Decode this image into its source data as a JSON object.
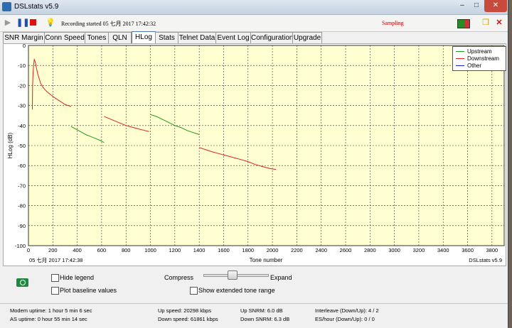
{
  "window": {
    "title": "DSLstats v5.9",
    "minimize": "–",
    "maximize": "□",
    "close": "✕"
  },
  "toolbar": {
    "recording_text": "Recording started 05 七月 2017 17:42:32",
    "sampling_text": "Sampling",
    "icons": [
      "play-icon",
      "pause-icon",
      "stop-icon",
      "lightbulb-icon",
      "battery-icon",
      "copy-icon",
      "close-red-icon"
    ]
  },
  "tabs": [
    "SNR Margin",
    "Conn Speed",
    "Tones",
    "QLN",
    "HLog",
    "Stats",
    "Telnet Data",
    "Event Log",
    "Configuration",
    "Upgrade"
  ],
  "active_tab": "HLog",
  "chart_data": {
    "type": "line",
    "title": "",
    "xlabel": "Tone number",
    "ylabel": "HLog (dB)",
    "xlim": [
      0,
      3900
    ],
    "ylim": [
      -100,
      0
    ],
    "xticks": [
      0,
      200,
      400,
      600,
      800,
      1000,
      1200,
      1400,
      1600,
      1800,
      2000,
      2200,
      2400,
      2600,
      2800,
      3000,
      3200,
      3400,
      3600,
      3800
    ],
    "yticks": [
      0,
      -10,
      -20,
      -30,
      -40,
      -50,
      -60,
      -70,
      -80,
      -90,
      -100
    ],
    "grid": true,
    "legend_position": "top-right",
    "timestamp": "05 七月 2017 17:42:38",
    "watermark": "DSLstats v5.9",
    "series": [
      {
        "name": "Upstream",
        "color": "#1a9a1a",
        "segments": [
          [
            [
              350,
              -40.5
            ],
            [
              410,
              -42.5
            ],
            [
              470,
              -44.5
            ],
            [
              530,
              -46
            ],
            [
              590,
              -47.5
            ],
            [
              620,
              -48.5
            ]
          ],
          [
            [
              1000,
              -34.5
            ],
            [
              1050,
              -35.5
            ],
            [
              1100,
              -37
            ],
            [
              1150,
              -38.5
            ],
            [
              1200,
              -40
            ],
            [
              1250,
              -41
            ],
            [
              1300,
              -42.5
            ],
            [
              1350,
              -43.5
            ],
            [
              1400,
              -44.5
            ]
          ]
        ]
      },
      {
        "name": "Downstream",
        "color": "#e02020",
        "segments": [
          [
            [
              32,
              -32
            ],
            [
              34,
              -20
            ],
            [
              38,
              -14
            ],
            [
              42,
              -10
            ],
            [
              48,
              -7
            ],
            [
              55,
              -8
            ],
            [
              65,
              -11
            ],
            [
              75,
              -14
            ],
            [
              85,
              -16
            ],
            [
              100,
              -19
            ],
            [
              120,
              -21
            ],
            [
              150,
              -23
            ],
            [
              200,
              -25.5
            ],
            [
              250,
              -27.5
            ],
            [
              300,
              -29.5
            ],
            [
              350,
              -30.5
            ]
          ],
          [
            [
              620,
              -35.5
            ],
            [
              680,
              -37
            ],
            [
              740,
              -38.5
            ],
            [
              800,
              -40
            ],
            [
              860,
              -41
            ],
            [
              920,
              -42
            ],
            [
              990,
              -43
            ]
          ],
          [
            [
              1400,
              -51
            ],
            [
              1450,
              -52
            ],
            [
              1500,
              -53
            ],
            [
              1560,
              -54
            ],
            [
              1620,
              -55
            ],
            [
              1680,
              -56
            ],
            [
              1740,
              -57
            ],
            [
              1800,
              -58
            ],
            [
              1860,
              -59.5
            ],
            [
              1920,
              -60.5
            ],
            [
              1980,
              -61.5
            ],
            [
              2030,
              -62
            ]
          ]
        ]
      },
      {
        "name": "Other",
        "color": "#2020d0",
        "segments": []
      }
    ]
  },
  "controls": {
    "hide_legend": "Hide legend",
    "plot_baseline": "Plot baseline values",
    "compress": "Compress",
    "expand": "Expand",
    "show_extended": "Show extended tone range",
    "camera_icon": "camera-icon"
  },
  "status": {
    "modem_uptime": "Modem uptime:  1 hour 5 min 6 sec",
    "as_uptime": "AS uptime:  0 hour 55 min 14 sec",
    "up_speed": "Up speed: 20298 kbps",
    "down_speed": "Down speed: 61861 kbps",
    "up_snrm": "Up SNRM: 6.0 dB",
    "down_snrm": "Down SNRM: 6.3 dB",
    "interleave": "Interleave (Down/Up): 4 / 2",
    "es_hour": "ES/hour (Down/Up): 0 / 0"
  }
}
